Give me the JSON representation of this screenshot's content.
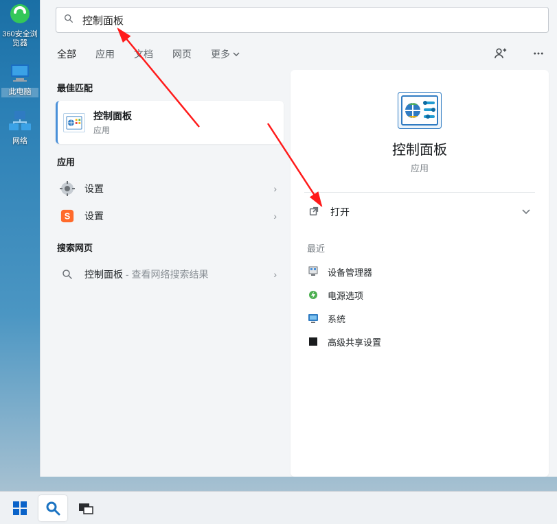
{
  "desktop": {
    "icons": [
      {
        "label": "360安全浏览器",
        "name": "desktop-icon-360",
        "kind": "browser"
      },
      {
        "label": "此电脑",
        "name": "desktop-icon-this-pc",
        "kind": "pc"
      },
      {
        "label": "网络",
        "name": "desktop-icon-network",
        "kind": "network"
      }
    ]
  },
  "search": {
    "query": "控制面板",
    "tabs": [
      {
        "label": "全部",
        "active": true
      },
      {
        "label": "应用",
        "active": false
      },
      {
        "label": "文档",
        "active": false
      },
      {
        "label": "网页",
        "active": false
      }
    ],
    "more_label": "更多"
  },
  "sections": {
    "best_match_label": "最佳匹配",
    "apps_label": "应用",
    "web_label": "搜索网页"
  },
  "best_match": {
    "title": "控制面板",
    "subtitle": "应用"
  },
  "app_results": [
    {
      "label": "设置",
      "icon": "gear-icon"
    },
    {
      "label": "设置",
      "icon": "sogou-icon"
    }
  ],
  "web_result": {
    "prefix": "控制面板",
    "suffix": " - 查看网络搜索结果"
  },
  "detail": {
    "title": "控制面板",
    "subtitle": "应用",
    "open_label": "打开",
    "recent_label": "最近",
    "recent": [
      {
        "label": "设备管理器",
        "icon": "device-manager-icon"
      },
      {
        "label": "电源选项",
        "icon": "power-options-icon"
      },
      {
        "label": "系统",
        "icon": "system-icon"
      },
      {
        "label": "高级共享设置",
        "icon": "sharing-icon"
      }
    ]
  },
  "taskbar": {
    "buttons": [
      {
        "name": "start-button",
        "kind": "start"
      },
      {
        "name": "search-button",
        "kind": "search",
        "active": true
      },
      {
        "name": "task-view-button",
        "kind": "taskview"
      }
    ]
  }
}
